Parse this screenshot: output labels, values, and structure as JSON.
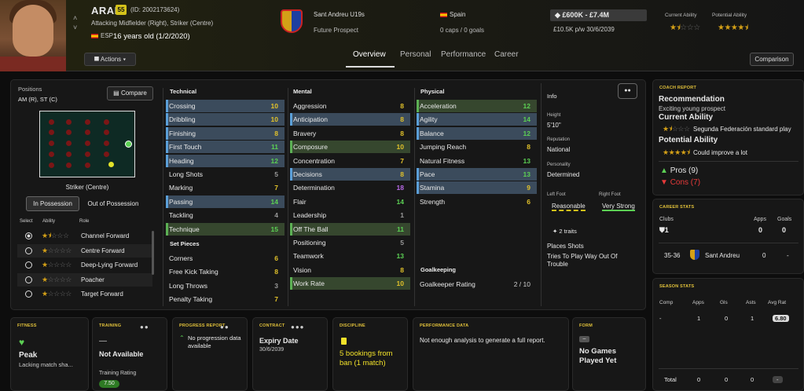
{
  "header": {
    "name": "ARAN",
    "ca_badge": "55",
    "id": "(ID: 2002173624)",
    "positions": "Attacking Midfielder (Right), Striker (Centre)",
    "nationality": "ESP",
    "age": "16 years old (1/2/2020)",
    "actions_label": "Actions",
    "club": "Sant Andreu U19s",
    "status": "Future Prospect",
    "nation": "Spain",
    "caps": "0 caps / 0 goals",
    "value": "£600K - £7.4M",
    "wage": "£10.5K p/w 30/6/2039",
    "current_ability_label": "Current Ability",
    "potential_ability_label": "Potential Ability",
    "current_ability_stars": 1.5,
    "potential_ability_stars": 4.5,
    "comparison_label": "Comparison"
  },
  "tabs": [
    "Overview",
    "Personal",
    "Performance",
    "Career"
  ],
  "positions_panel": {
    "title": "Positions",
    "value": "AM (R), ST (C)",
    "compare_label": "Compare",
    "role_label": "Striker (Centre)",
    "in_possession": "In Possession",
    "out_possession": "Out of Possession",
    "col_select": "Select",
    "col_ability": "Ability",
    "col_role": "Role",
    "roles": [
      {
        "name": "Channel Forward",
        "stars": 1.5
      },
      {
        "name": "Centre Forward",
        "stars": 1
      },
      {
        "name": "Deep-Lying Forward",
        "stars": 1
      },
      {
        "name": "Poacher",
        "stars": 1
      },
      {
        "name": "Target Forward",
        "stars": 1
      }
    ]
  },
  "technical": {
    "title": "Technical",
    "items": [
      {
        "n": "Crossing",
        "v": "10",
        "h": "b",
        "c": "y"
      },
      {
        "n": "Dribbling",
        "v": "10",
        "h": "b",
        "c": "y"
      },
      {
        "n": "Finishing",
        "v": "8",
        "h": "b",
        "c": "y"
      },
      {
        "n": "First Touch",
        "v": "11",
        "h": "b",
        "c": "g"
      },
      {
        "n": "Heading",
        "v": "12",
        "h": "b",
        "c": "g"
      },
      {
        "n": "Long Shots",
        "v": "5",
        "h": "",
        "c": "gr"
      },
      {
        "n": "Marking",
        "v": "7",
        "h": "",
        "c": "y"
      },
      {
        "n": "Passing",
        "v": "14",
        "h": "b",
        "c": "g"
      },
      {
        "n": "Tackling",
        "v": "4",
        "h": "",
        "c": "gr"
      },
      {
        "n": "Technique",
        "v": "15",
        "h": "g",
        "c": "g"
      }
    ]
  },
  "set_pieces": {
    "title": "Set Pieces",
    "items": [
      {
        "n": "Corners",
        "v": "6",
        "c": "y"
      },
      {
        "n": "Free Kick Taking",
        "v": "8",
        "c": "y"
      },
      {
        "n": "Long Throws",
        "v": "3",
        "c": "gr"
      },
      {
        "n": "Penalty Taking",
        "v": "7",
        "c": "y"
      }
    ]
  },
  "mental": {
    "title": "Mental",
    "items": [
      {
        "n": "Aggression",
        "v": "8",
        "h": "",
        "c": "y"
      },
      {
        "n": "Anticipation",
        "v": "8",
        "h": "b",
        "c": "y"
      },
      {
        "n": "Bravery",
        "v": "8",
        "h": "",
        "c": "y"
      },
      {
        "n": "Composure",
        "v": "10",
        "h": "g",
        "c": "y"
      },
      {
        "n": "Concentration",
        "v": "7",
        "h": "",
        "c": "y"
      },
      {
        "n": "Decisions",
        "v": "8",
        "h": "b",
        "c": "y"
      },
      {
        "n": "Determination",
        "v": "18",
        "h": "",
        "c": "p"
      },
      {
        "n": "Flair",
        "v": "14",
        "h": "",
        "c": "g"
      },
      {
        "n": "Leadership",
        "v": "1",
        "h": "",
        "c": "gr"
      },
      {
        "n": "Off The Ball",
        "v": "11",
        "h": "g",
        "c": "g"
      },
      {
        "n": "Positioning",
        "v": "5",
        "h": "",
        "c": "gr"
      },
      {
        "n": "Teamwork",
        "v": "13",
        "h": "",
        "c": "g"
      },
      {
        "n": "Vision",
        "v": "8",
        "h": "",
        "c": "y"
      },
      {
        "n": "Work Rate",
        "v": "10",
        "h": "g",
        "c": "y"
      }
    ]
  },
  "physical": {
    "title": "Physical",
    "items": [
      {
        "n": "Acceleration",
        "v": "12",
        "h": "g",
        "c": "g"
      },
      {
        "n": "Agility",
        "v": "14",
        "h": "b",
        "c": "g"
      },
      {
        "n": "Balance",
        "v": "12",
        "h": "b",
        "c": "g"
      },
      {
        "n": "Jumping Reach",
        "v": "8",
        "h": "",
        "c": "y"
      },
      {
        "n": "Natural Fitness",
        "v": "13",
        "h": "",
        "c": "g"
      },
      {
        "n": "Pace",
        "v": "13",
        "h": "b",
        "c": "g"
      },
      {
        "n": "Stamina",
        "v": "9",
        "h": "b",
        "c": "y"
      },
      {
        "n": "Strength",
        "v": "6",
        "h": "",
        "c": "y"
      }
    ]
  },
  "goalkeeping": {
    "title": "Goalkeeping",
    "label": "Goalkeeper Rating",
    "value": "2 / 10"
  },
  "info": {
    "title": "Info",
    "height_label": "Height",
    "height": "5'10\"",
    "rep_label": "Reputation",
    "rep": "National",
    "pers_label": "Personality",
    "pers": "Determined",
    "left_foot_label": "Left Foot",
    "right_foot_label": "Right Foot",
    "left_foot": "Reasonable",
    "right_foot": "Very Strong",
    "traits": "2 traits",
    "trait1": "Places Shots",
    "trait2": "Tries To Play Way Out Of Trouble"
  },
  "coach": {
    "title": "COACH REPORT",
    "rec": "Recommendation",
    "rec_text": "Exciting young prospect",
    "ca": "Current Ability",
    "ca_text": "Segunda Federación standard play",
    "pa": "Potential Ability",
    "pa_text": "Could improve a lot",
    "pros": "Pros (9)",
    "cons": "Cons (7)"
  },
  "career": {
    "title": "CAREER STATS",
    "clubs": "Clubs",
    "clubs_val": "1",
    "apps": "Apps",
    "goals": "Goals",
    "apps_val": "0",
    "goals_val": "0",
    "season": "35-36",
    "club": "Sant Andreu",
    "row_apps": "0",
    "row_goals": "-"
  },
  "season": {
    "title": "SEASON STATS",
    "cols": [
      "Comp",
      "Apps",
      "Gls",
      "Asts",
      "Avg Rat"
    ],
    "row": [
      "-",
      "1",
      "0",
      "1",
      "6.80"
    ],
    "total": [
      "Total",
      "0",
      "0",
      "0",
      "-"
    ]
  },
  "cards": {
    "fitness": {
      "title": "FITNESS",
      "value": "Peak",
      "sub": "Lacking match sha..."
    },
    "training": {
      "title": "TRAINING",
      "dash": "—",
      "value": "Not Available",
      "rating_label": "Training Rating",
      "rating": "7.50"
    },
    "progress": {
      "title": "PROGRESS REPORT",
      "text": "No progression data available"
    },
    "contract": {
      "title": "CONTRACT",
      "value": "Expiry Date",
      "date": "30/6/2039"
    },
    "discipline": {
      "title": "DISCIPLINE",
      "text": "5 bookings from ban (1 match)"
    },
    "performance": {
      "title": "PERFORMANCE DATA",
      "text": "Not enough analysis to generate a full report."
    },
    "form": {
      "title": "FORM",
      "text": "No Games Played Yet"
    }
  }
}
